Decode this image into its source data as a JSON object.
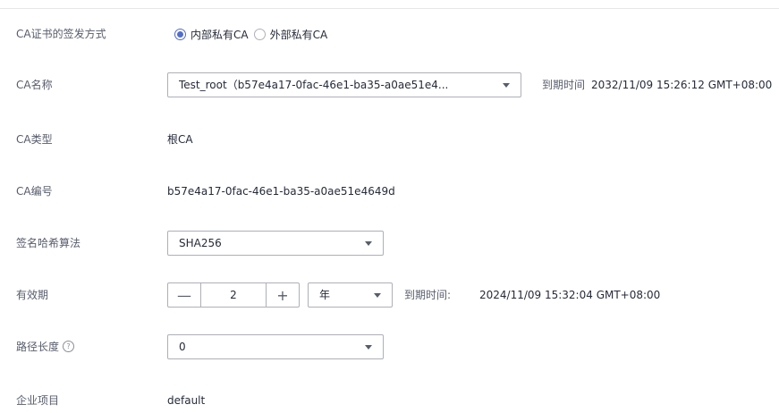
{
  "fields": {
    "issue_method": {
      "label": "CA证书的签发方式",
      "options": [
        "内部私有CA",
        "外部私有CA"
      ],
      "selected": "内部私有CA"
    },
    "ca_name": {
      "label": "CA名称",
      "selected": "Test_root（b57e4a17-0fac-46e1-ba35-a0ae51e4...",
      "expiry_label": "到期时间",
      "expiry_value": "2032/11/09 15:26:12 GMT+08:00"
    },
    "ca_type": {
      "label": "CA类型",
      "value": "根CA"
    },
    "ca_id": {
      "label": "CA编号",
      "value": "b57e4a17-0fac-46e1-ba35-a0ae51e4649d"
    },
    "hash_algorithm": {
      "label": "签名哈希算法",
      "selected": "SHA256"
    },
    "validity": {
      "label": "有效期",
      "minus": "—",
      "value": "2",
      "plus": "+",
      "unit": "年",
      "expiry_label": "到期时间:",
      "expiry_value": "2024/11/09 15:32:04 GMT+08:00"
    },
    "path_length": {
      "label": "路径长度",
      "help_icon": "question-circle-icon",
      "help_glyph": "?",
      "selected": "0"
    },
    "enterprise_project": {
      "label": "企业项目",
      "value": "default"
    }
  },
  "colors": {
    "accent": "#526ecc",
    "border": "#adb0b8",
    "label": "#575d6c",
    "text": "#252b3a"
  }
}
